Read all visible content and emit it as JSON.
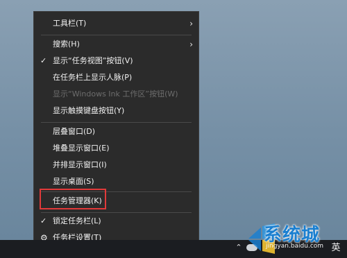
{
  "menu": {
    "items": [
      {
        "label": "工具栏(T)"
      },
      {
        "label": "搜索(H)"
      },
      {
        "label": "显示“任务视图”按钮(V)"
      },
      {
        "label": "在任务栏上显示人脉(P)"
      },
      {
        "label": "显示“Windows Ink 工作区”按钮(W)"
      },
      {
        "label": "显示触摸键盘按钮(Y)"
      },
      {
        "label": "层叠窗口(D)"
      },
      {
        "label": "堆叠显示窗口(E)"
      },
      {
        "label": "并排显示窗口(I)"
      },
      {
        "label": "显示桌面(S)"
      },
      {
        "label": "任务管理器(K)"
      },
      {
        "label": "锁定任务栏(L)"
      },
      {
        "label": "任务栏设置(T)"
      }
    ]
  },
  "tray": {
    "ime_label": "英"
  },
  "watermark": {
    "title": "系统城",
    "url": "jingyan.baidu.com"
  },
  "colors": {
    "menu_bg": "#2b2b2b",
    "highlight_border": "#e23a3a",
    "taskbar_bg": "#1b1d21",
    "brand_blue": "#1a7fd0"
  },
  "icons": {
    "submenu": "chevron-right-icon",
    "checked": "checkmark-icon",
    "settings": "gear-icon",
    "tray_overflow": "chevron-up-icon"
  }
}
